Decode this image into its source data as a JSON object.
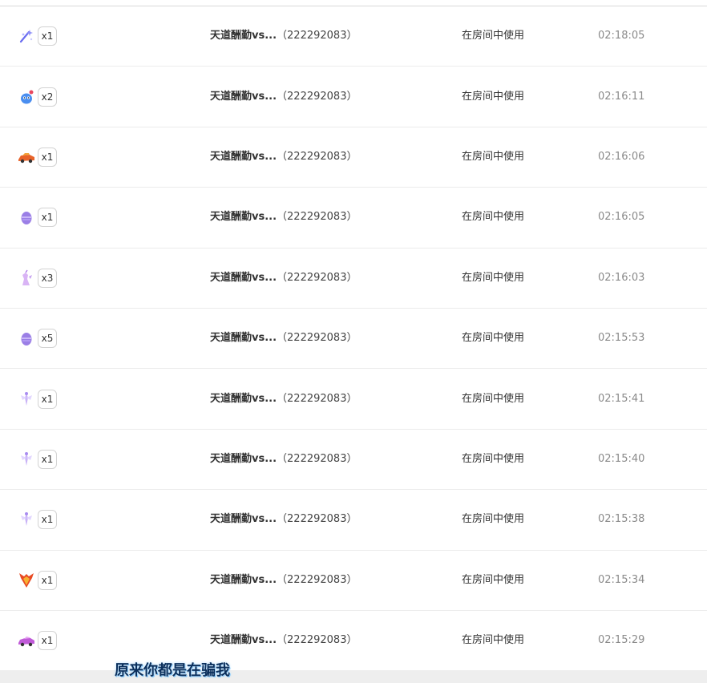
{
  "rows": [
    {
      "icon": "wand-sparkle-icon",
      "qty": "x1",
      "room_name": "天道酬勤vs...",
      "room_id": "（222292083）",
      "usage": "在房间中使用",
      "time": "02:18:05"
    },
    {
      "icon": "cute-monster-icon",
      "qty": "x2",
      "room_name": "天道酬勤vs...",
      "room_id": "（222292083）",
      "usage": "在房间中使用",
      "time": "02:16:11"
    },
    {
      "icon": "race-car-icon",
      "qty": "x1",
      "room_name": "天道酬勤vs...",
      "room_id": "（222292083）",
      "usage": "在房间中使用",
      "time": "02:16:06"
    },
    {
      "icon": "purple-egg-icon",
      "qty": "x1",
      "room_name": "天道酬勤vs...",
      "room_id": "（222292083）",
      "usage": "在房间中使用",
      "time": "02:16:05"
    },
    {
      "icon": "unicorn-icon",
      "qty": "x3",
      "room_name": "天道酬勤vs...",
      "room_id": "（222292083）",
      "usage": "在房间中使用",
      "time": "02:16:03"
    },
    {
      "icon": "purple-egg-icon",
      "qty": "x5",
      "room_name": "天道酬勤vs...",
      "room_id": "（222292083）",
      "usage": "在房间中使用",
      "time": "02:15:53"
    },
    {
      "icon": "fairy-icon",
      "qty": "x1",
      "room_name": "天道酬勤vs...",
      "room_id": "（222292083）",
      "usage": "在房间中使用",
      "time": "02:15:41"
    },
    {
      "icon": "fairy-icon",
      "qty": "x1",
      "room_name": "天道酬勤vs...",
      "room_id": "（222292083）",
      "usage": "在房间中使用",
      "time": "02:15:40"
    },
    {
      "icon": "fairy-icon",
      "qty": "x1",
      "room_name": "天道酬勤vs...",
      "room_id": "（222292083）",
      "usage": "在房间中使用",
      "time": "02:15:38"
    },
    {
      "icon": "phoenix-icon",
      "qty": "x1",
      "room_name": "天道酬勤vs...",
      "room_id": "（222292083）",
      "usage": "在房间中使用",
      "time": "02:15:34"
    },
    {
      "icon": "sports-car-icon",
      "qty": "x1",
      "room_name": "天道酬勤vs...",
      "room_id": "（222292083）",
      "usage": "在房间中使用",
      "time": "02:15:29"
    }
  ],
  "subtitle": "原来你都是在骗我",
  "colors": {
    "text": "#333333",
    "time": "#8a8a8a",
    "divider": "#ececec",
    "subtitle": "#0a2f5c"
  }
}
